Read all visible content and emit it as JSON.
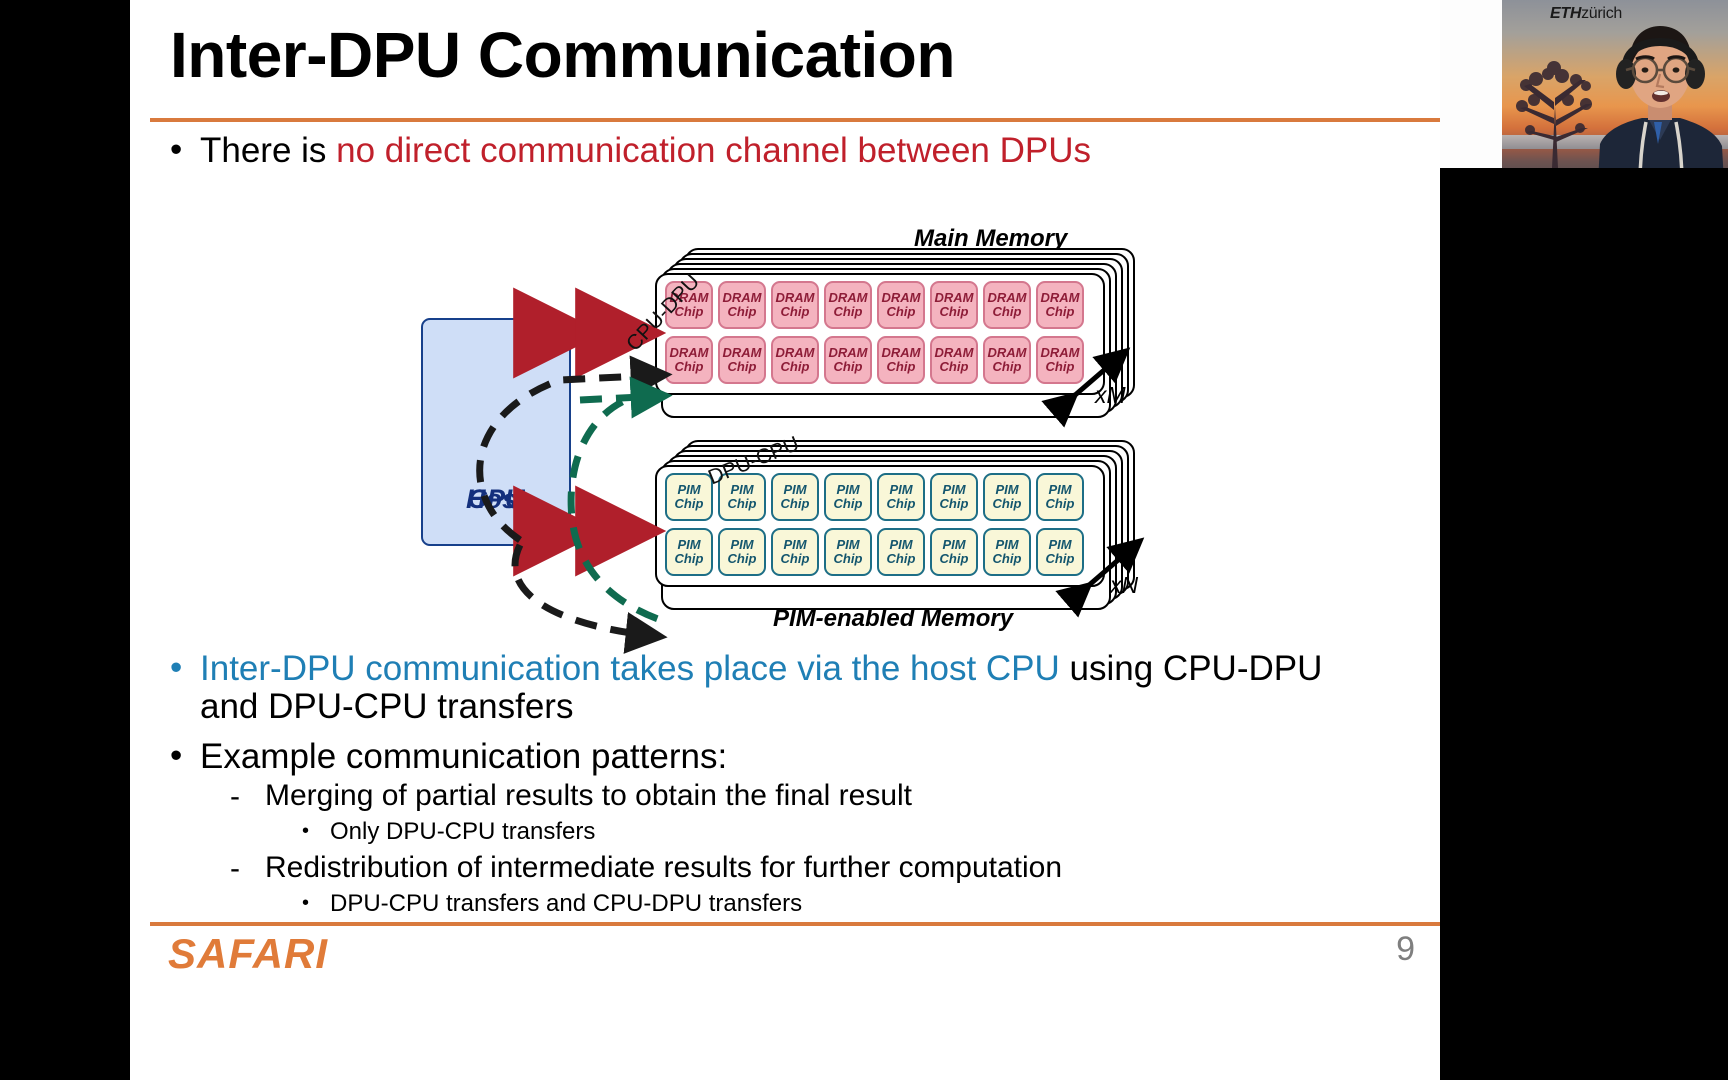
{
  "slide": {
    "title": "Inter-DPU Communication",
    "page_number": "9",
    "logo": "SAFARI",
    "accent_color": "#d97a3d",
    "bullets": {
      "b1_prefix": "There is ",
      "b1_highlight": "no direct communication channel between DPUs",
      "b1_highlight_color": "#c0202b",
      "b2_highlight": "Inter-DPU communication takes place via the host CPU",
      "b2_highlight_color": "#1f7fb5",
      "b2_rest": " using CPU-DPU",
      "b2_line2": "and DPU-CPU transfers",
      "b3": "Example communication patterns:",
      "sub1": "Merging of partial results to obtain the final result",
      "sub1_sub": "Only DPU-CPU transfers",
      "sub2": "Redistribution of intermediate results for further computation",
      "sub2_sub": "DPU-CPU transfers and CPU-DPU transfers",
      "dash_marker": "-",
      "dot_marker": "•"
    },
    "diagram": {
      "main_memory_label": "Main Memory",
      "pim_memory_label": "PIM-enabled Memory",
      "host_cpu_label_line1": "Host",
      "host_cpu_label_line2": "CPU",
      "host_cpu_fill": "#cfdef7",
      "host_cpu_border": "#17408b",
      "curve_label_cpu_dpu": "CPU-DPU",
      "curve_label_dpu_cpu": "DPU-CPU",
      "multiplier_dram": "xM",
      "multiplier_pim": "xN",
      "dram_chip_line1": "DRAM",
      "dram_chip_line2": "Chip",
      "pim_chip_line1": "PIM",
      "pim_chip_line2": "Chip",
      "dram_chip_fill": "#f4b3bf",
      "dram_chip_border": "#d4778e",
      "dram_chip_text": "#8e1d38",
      "pim_chip_fill": "#f9f7d8",
      "pim_chip_border": "#1d6e86",
      "pim_chip_text": "#14566e",
      "bidirectional_arrow_color": "#b01f2b",
      "cpu_dpu_arrow_color": "#1a1a1a",
      "dpu_cpu_arrow_color": "#0f6b4f",
      "dram_chips_per_row": 8,
      "dram_rows": 2,
      "pim_chips_per_row": 8,
      "pim_rows": 2
    }
  },
  "webcam": {
    "institution_bold": "ETH",
    "institution_light": "zürich"
  }
}
